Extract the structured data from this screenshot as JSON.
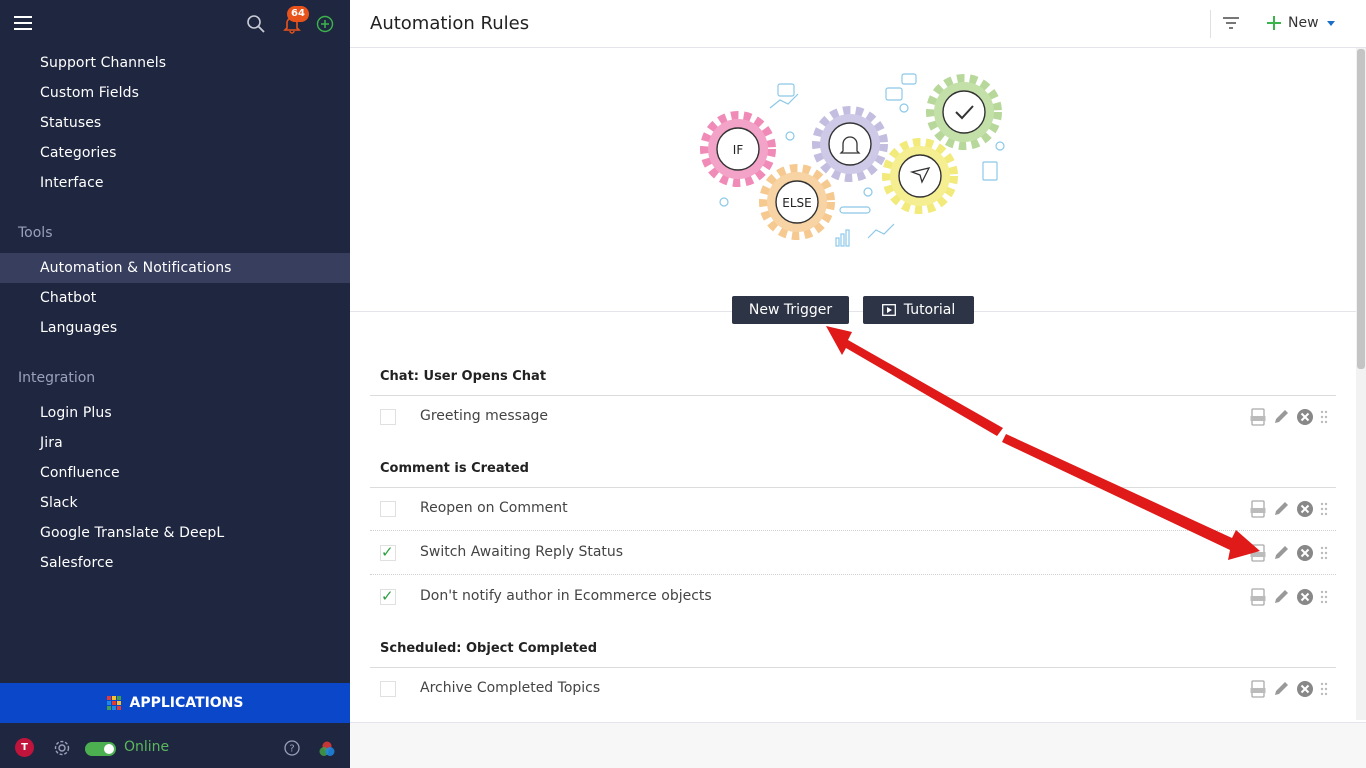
{
  "sidebar": {
    "badge_count": "64",
    "items_top": [
      {
        "label": "Support Channels"
      },
      {
        "label": "Custom Fields"
      },
      {
        "label": "Statuses"
      },
      {
        "label": "Categories"
      },
      {
        "label": "Interface"
      }
    ],
    "tools_heading": "Tools",
    "tools_items": [
      {
        "label": "Automation & Notifications",
        "active": true
      },
      {
        "label": "Chatbot"
      },
      {
        "label": "Languages"
      }
    ],
    "integration_heading": "Integration",
    "integration_items": [
      {
        "label": "Login Plus"
      },
      {
        "label": "Jira"
      },
      {
        "label": "Confluence"
      },
      {
        "label": "Slack"
      },
      {
        "label": "Google Translate & DeepL"
      },
      {
        "label": "Salesforce"
      }
    ],
    "applications_label": "APPLICATIONS",
    "avatar_initial": "T",
    "status_label": "Online"
  },
  "header": {
    "title": "Automation Rules",
    "new_label": "New"
  },
  "illustration": {
    "if_label": "IF",
    "else_label": "ELSE"
  },
  "buttons": {
    "new_trigger": "New Trigger",
    "tutorial": "Tutorial"
  },
  "groups": [
    {
      "title": "Chat: User Opens Chat",
      "rules": [
        {
          "label": "Greeting message",
          "checked": false
        }
      ]
    },
    {
      "title": "Comment is Created",
      "rules": [
        {
          "label": "Reopen on Comment",
          "checked": false
        },
        {
          "label": "Switch Awaiting Reply Status",
          "checked": true
        },
        {
          "label": "Don't notify author in Ecommerce objects",
          "checked": true
        }
      ]
    },
    {
      "title": "Scheduled: Object Completed",
      "rules": [
        {
          "label": "Archive Completed Topics",
          "checked": false
        }
      ]
    }
  ],
  "colors": {
    "sidebar_bg": "#1f2640",
    "active_item_bg": "#373e5e",
    "applications_bg": "#0b47c9",
    "dark_button": "#2d3446",
    "badge": "#e8531c",
    "online_green": "#5cb85c",
    "annotation_arrow": "#e01919"
  }
}
